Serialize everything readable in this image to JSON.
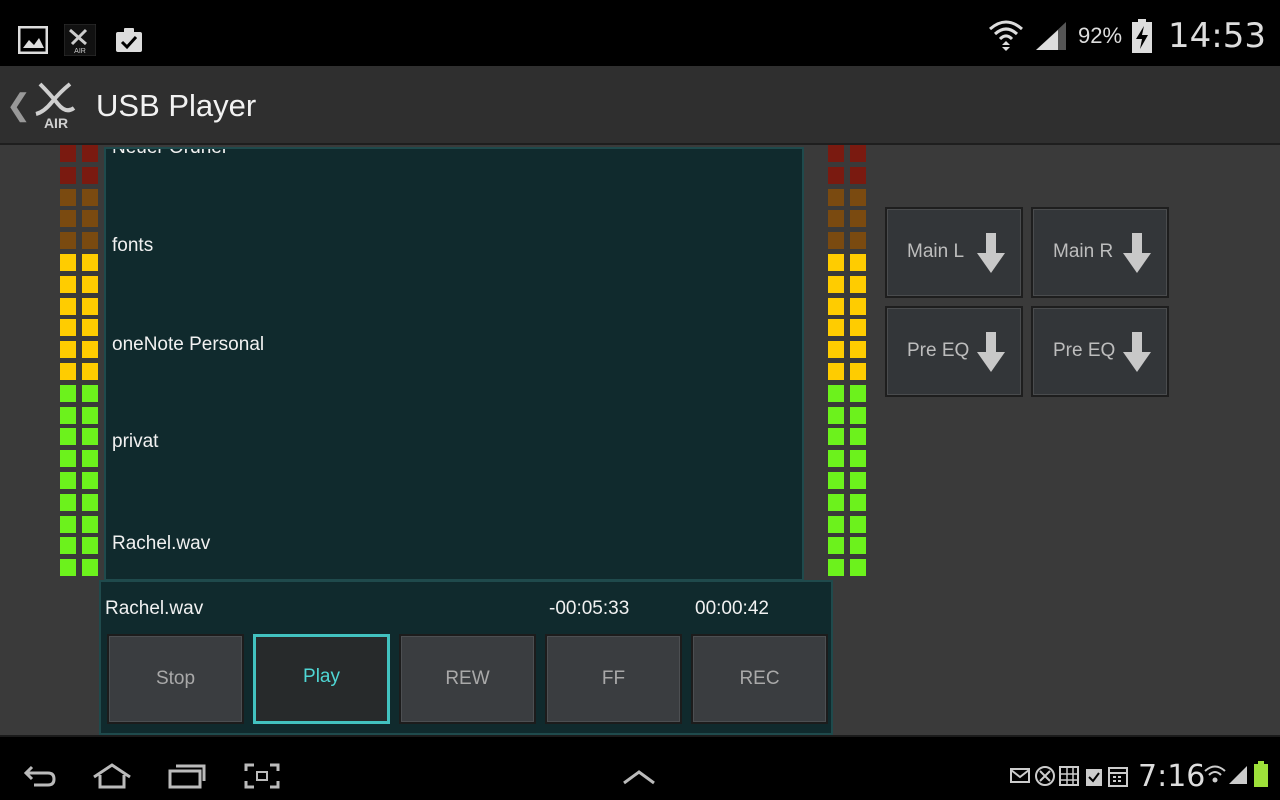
{
  "status_bar": {
    "left_icons": [
      "gallery-icon",
      "x-air-app-icon",
      "clipboard-check-icon"
    ],
    "right_icons": [
      "wifi-icon",
      "cell-signal-icon",
      "battery-charging-icon"
    ],
    "battery_percent": "92%",
    "time": "14:53"
  },
  "action_bar": {
    "back_icon": "chevron-left-icon",
    "logo_text": "AIR",
    "title": "USB Player"
  },
  "meters": {
    "left_level_fraction": 0.78,
    "right_level_fraction": 0.82,
    "colors": {
      "green": "#6cf21c",
      "yellow": "#ffcc00",
      "orange": "#7a4a10",
      "red": "#7a1a10"
    }
  },
  "file_list": {
    "items": [
      "Neuer Ordner",
      "fonts",
      "oneNote Personal",
      "privat",
      "Rachel.wav"
    ]
  },
  "routing": {
    "buttons": [
      {
        "label": "Main L",
        "icon": "arrow-down-icon"
      },
      {
        "label": "Main R",
        "icon": "arrow-down-icon"
      },
      {
        "label": "Pre EQ",
        "icon": "arrow-down-icon"
      },
      {
        "label": "Pre EQ",
        "icon": "arrow-down-icon"
      }
    ]
  },
  "transport": {
    "current_file": "Rachel.wav",
    "remaining": "-00:05:33",
    "elapsed": "00:00:42",
    "buttons": [
      {
        "label": "Stop",
        "active": false
      },
      {
        "label": "Play",
        "active": true
      },
      {
        "label": "REW",
        "active": false
      },
      {
        "label": "FF",
        "active": false
      },
      {
        "label": "REC",
        "active": false
      }
    ],
    "accent_color": "#42c2c0"
  },
  "nav_bar": {
    "left_icons": [
      "back-icon",
      "home-icon",
      "recent-apps-icon",
      "screenshot-icon"
    ],
    "center_icon": "chevron-up-icon",
    "right_icons": [
      "mail-icon",
      "x-air-icon",
      "store-icon",
      "clipboard-icon",
      "calendar-icon",
      "wifi-icon",
      "signal-icon",
      "battery-icon"
    ],
    "time": "7:16"
  }
}
